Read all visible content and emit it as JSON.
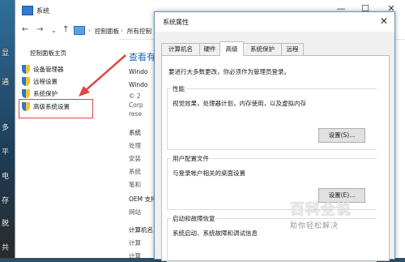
{
  "desktop": {
    "labels": [
      "显",
      "通",
      "多",
      "平",
      "电",
      "存",
      "脱",
      "共"
    ]
  },
  "back_window": {
    "title": "系统",
    "breadcrumb": [
      "控制面板",
      "所有控制"
    ],
    "left_pane": {
      "home": "控制面板主页",
      "items": [
        {
          "label": "设备管理器"
        },
        {
          "label": "远程设置"
        },
        {
          "label": "系统保护"
        },
        {
          "label": "高级系统设置"
        }
      ]
    },
    "content": {
      "heading": "查看有",
      "windows_edition": "Windo",
      "windows_line2": "Windo",
      "copyright_lines": [
        "© 2",
        "Corp",
        "rese"
      ],
      "system_section": "系统",
      "system_lines": [
        "处理",
        "安装",
        "系统",
        "笔和"
      ],
      "oem_section": "OEM 支持",
      "oem_lines": [
        "网站"
      ],
      "computer_section": "计算机名",
      "computer_lines": [
        "计算",
        "计算"
      ]
    }
  },
  "dialog": {
    "title": "系统属性",
    "tabs": [
      "计算机名",
      "硬件",
      "高级",
      "系统保护",
      "远程"
    ],
    "active_tab": "高级",
    "notice": "要进行大多数更改，你必须作为管理员登录。",
    "groups": [
      {
        "title": "性能",
        "desc": "视觉效果，处理器计划，内存使用，以及虚拟内存",
        "button": "设置(S)..."
      },
      {
        "title": "用户配置文件",
        "desc": "与登录帐户相关的桌面设置",
        "button": "设置(E)..."
      },
      {
        "title": "启动和故障恢复",
        "desc": "系统启动、系统故障和调试信息"
      }
    ]
  },
  "watermark": {
    "logo": "百科全说",
    "sub": "助你轻松解决"
  },
  "colors": {
    "highlight_box": "#e04545",
    "link_blue": "#1e6bb8",
    "shield_blue": "#2f78c4",
    "shield_yellow": "#f2c230"
  }
}
